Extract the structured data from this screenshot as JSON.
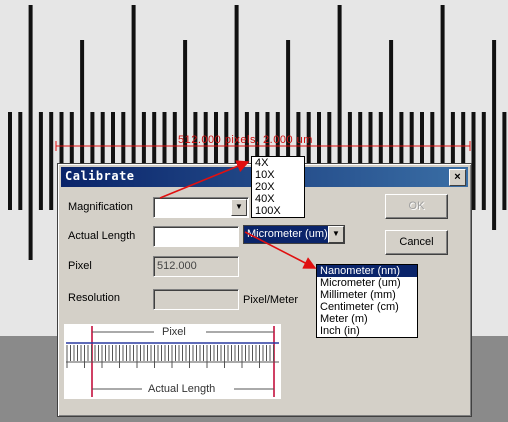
{
  "measurement": {
    "label": "512.000 pixels, 2.000 um"
  },
  "dialog": {
    "title": "Calibrate",
    "close_label": "×",
    "magnification_label": "Magnification",
    "magnification_value": "",
    "actual_length_label": "Actual Length",
    "actual_length_value": "",
    "unit_value": "Micrometer (um)",
    "pixel_label": "Pixel",
    "pixel_value": "512.000",
    "resolution_label": "Resolution",
    "resolution_value": "",
    "resolution_unit": "Pixel/Meter",
    "ok_label": "OK",
    "cancel_label": "Cancel",
    "illustration": {
      "top_label": "Pixel",
      "bottom_label": "Actual Length"
    }
  },
  "magnification_options": [
    "4X",
    "10X",
    "20X",
    "40X",
    "100X"
  ],
  "unit_options": [
    "Nanometer (nm)",
    "Micrometer (um)",
    "Millimeter (mm)",
    "Centimeter (cm)",
    "Meter (m)",
    "Inch (in)"
  ],
  "unit_options_selected": "Nanometer (nm)",
  "colors": {
    "accent_red": "#e01010",
    "title_blue": "#0a246a",
    "dialog_gray": "#d4d0c8"
  }
}
